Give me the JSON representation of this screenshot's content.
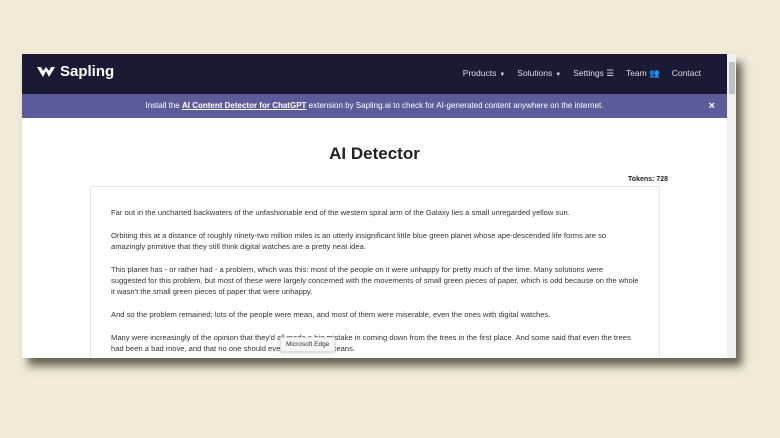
{
  "nav": {
    "brand": "Sapling",
    "items": [
      {
        "label": "Products",
        "caret": true
      },
      {
        "label": "Solutions",
        "caret": true
      },
      {
        "label": "Settings",
        "icon": "sliders-icon"
      },
      {
        "label": "Team",
        "icon": "users-icon"
      },
      {
        "label": "Contact"
      }
    ]
  },
  "banner": {
    "prefix": "Install the ",
    "link": "AI Content Detector for ChatGPT",
    "suffix": " extension by Sapling.ai to check for AI-generated content anywhere on the internet.",
    "close": "×"
  },
  "main": {
    "title": "AI Detector",
    "tokens": "Tokens: 728",
    "paragraphs": [
      "Far out in the uncharted backwaters of the unfashionable end of the western spiral arm of the Galaxy lies a small unregarded yellow sun.",
      "Orbiting this at a distance of roughly ninety-two million miles is an utterly insignificant little blue green planet whose ape-descended life forms are so amazingly primitive that they still think digital watches are a pretty neat idea.",
      "This planet has - or rather had - a problem, which was this: most of the people on it were unhappy for pretty much of the time. Many solutions were suggested for this problem, but most of these were largely concerned with the movements of small green pieces of paper, which is odd because on the whole it wasn't the small green pieces of paper that were unhappy.",
      "And so the problem remained; lots of the people were mean, and most of them were miserable, even the ones with digital watches.",
      "Many were increasingly of the opinion that they'd all made a big mistake in coming down from the trees in the first place. And some said that even the trees had been a bad move, and that no one should ever have left the oceans."
    ]
  },
  "tooltip": "Microsoft Edge"
}
